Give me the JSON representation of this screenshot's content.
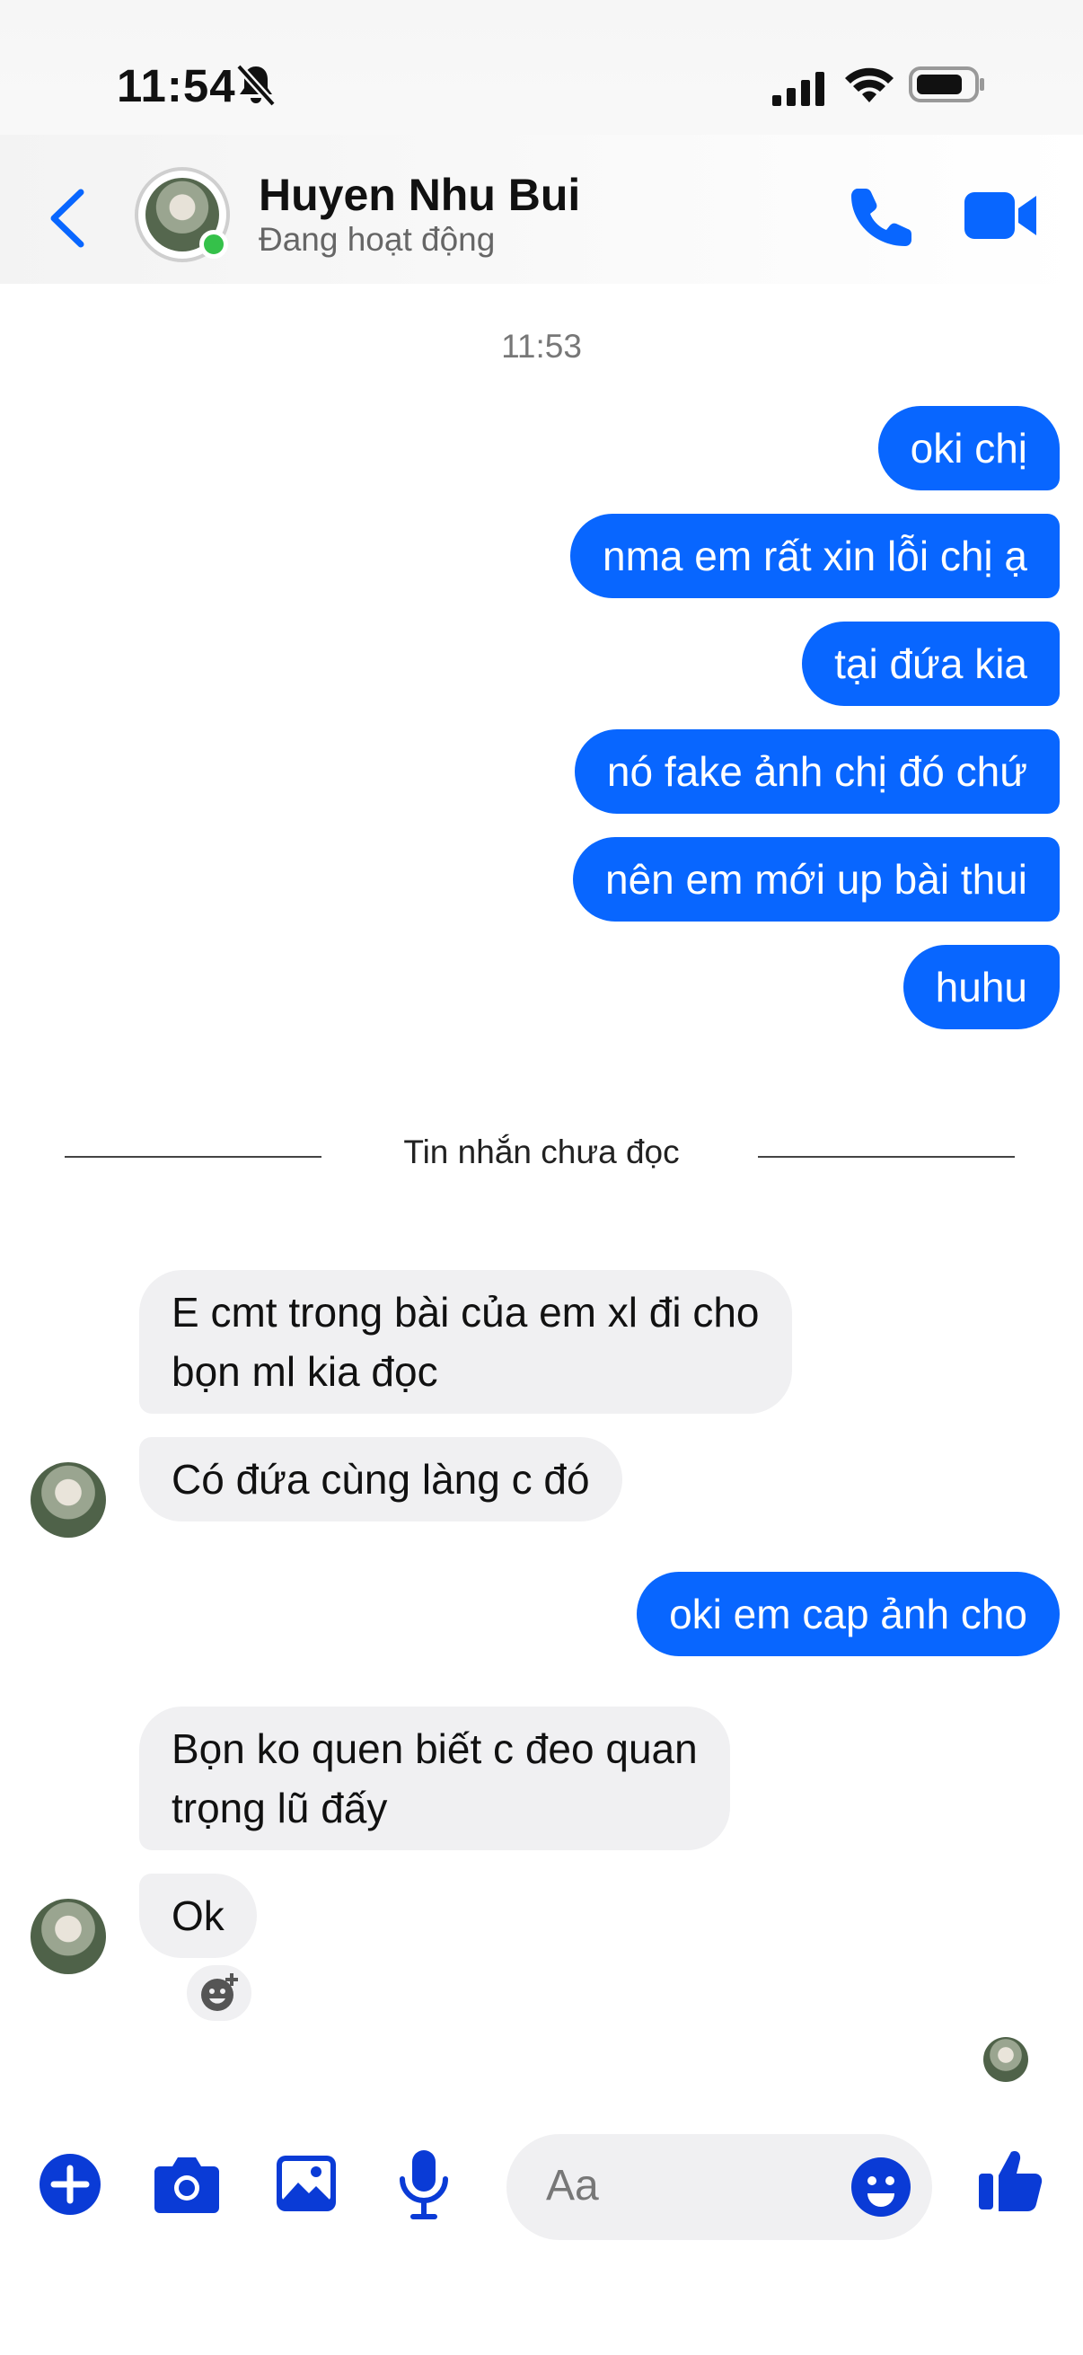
{
  "status_bar": {
    "time": "11:54"
  },
  "header": {
    "contact_name": "Huyen Nhu Bui",
    "presence": "Đang hoạt động"
  },
  "timestamp": "11:53",
  "messages_before": [
    {
      "text": "oki chị"
    },
    {
      "text": "nma em rất xin lỗi chị ạ"
    },
    {
      "text": "tại đứa kia"
    },
    {
      "text": "nó fake ảnh chị đó chứ"
    },
    {
      "text": "nên em mới up bài thui"
    },
    {
      "text": "huhu"
    }
  ],
  "unread_divider": "Tin nhắn chưa đọc",
  "messages_after": [
    {
      "line1": "E cmt trong bài của em xl đi cho",
      "line2": "bọn ml kia đọc"
    },
    {
      "text": "Có đứa cùng làng c đó"
    },
    {
      "text": "oki em cap ảnh cho"
    },
    {
      "line1": "Bọn ko quen biết c đeo quan",
      "line2": "trọng lũ đấy"
    },
    {
      "text": "Ok"
    }
  ],
  "composer": {
    "placeholder": "Aa",
    "icons": [
      "plus-icon",
      "camera-icon",
      "image-icon",
      "microphone-icon",
      "emoji-icon",
      "thumbs-up-icon"
    ]
  },
  "colors": {
    "accent": "#0866ff",
    "incoming_bubble": "#f0f0f2",
    "online": "#35c14a"
  }
}
